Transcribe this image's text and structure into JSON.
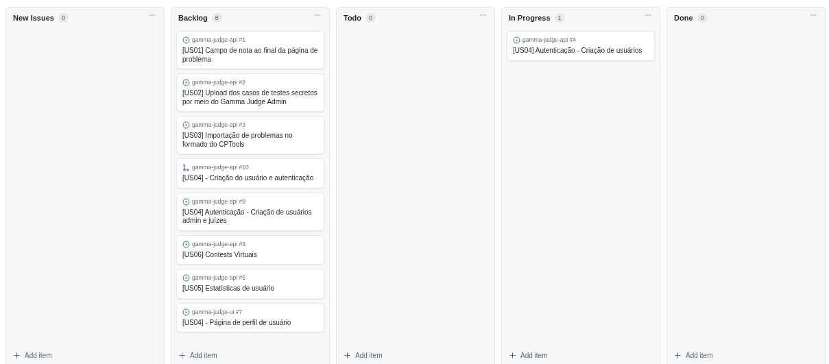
{
  "columns": [
    {
      "title": "New Issues",
      "count": "0",
      "add_label": "Add item"
    },
    {
      "title": "Backlog",
      "count": "8",
      "cards": [
        {
          "kind": "issue",
          "repo": "gamma-judge-api #1",
          "title": "[US01] Campo de nota ao final da página de problema"
        },
        {
          "kind": "issue",
          "repo": "gamma-judge-api #2",
          "title": "[US02] Upload dos casos de testes secretos por meio do Gamma Judge Admin"
        },
        {
          "kind": "issue",
          "repo": "gamma-judge-api #3",
          "title": "[US03] Importação de problemas no formado do CPTools"
        },
        {
          "kind": "pull_request",
          "repo": "gamma-judge-api #10",
          "title": "[US04] - Criação do usuário e autenticação"
        },
        {
          "kind": "issue",
          "repo": "gamma-judge-api #9",
          "title": "[US04] Autenticação - Criação de usuários admin e juízes"
        },
        {
          "kind": "issue",
          "repo": "gamma-judge-api #6",
          "title": "[US06] Contests Virtuais"
        },
        {
          "kind": "issue",
          "repo": "gamma-judge-api #5",
          "title": "[US05] Estatísticas de usuário"
        },
        {
          "kind": "issue",
          "repo": "gamma-judge-ui #7",
          "title": "[US04] - Página de perfil de usuário"
        }
      ],
      "add_label": "Add item"
    },
    {
      "title": "Todo",
      "count": "0",
      "add_label": "Add item"
    },
    {
      "title": "In Progress",
      "count": "1",
      "cards": [
        {
          "kind": "issue",
          "repo": "gamma-judge-api #4",
          "title": "[US04] Autenticação - Criação de usuários"
        }
      ],
      "add_label": "Add item"
    },
    {
      "title": "Done",
      "count": "0",
      "add_label": "Add item"
    }
  ]
}
